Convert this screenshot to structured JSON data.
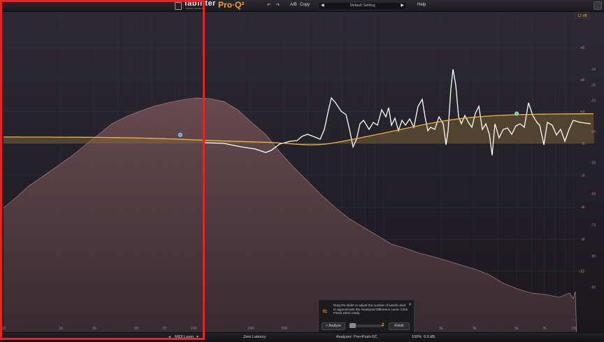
{
  "toolbar": {
    "undo_icon": "undo-icon",
    "redo_icon": "redo-icon",
    "ab_label": "A/B",
    "copy_label": "Copy",
    "preset_name": "Default Setting",
    "help_label": "Help"
  },
  "logo": {
    "brand": "fabfilter",
    "brand_sub": "software instruments",
    "product": "Pro·Q²"
  },
  "range": {
    "label": "12 dB"
  },
  "freq_axis": {
    "ticks": [
      {
        "label": "10",
        "hz": 10
      },
      {
        "label": "20",
        "hz": 20
      },
      {
        "label": "30",
        "hz": 30
      },
      {
        "label": "50",
        "hz": 50
      },
      {
        "label": "70",
        "hz": 70
      },
      {
        "label": "100",
        "hz": 100
      },
      {
        "label": "200",
        "hz": 200
      },
      {
        "label": "300",
        "hz": 300
      },
      {
        "label": "500",
        "hz": 500
      },
      {
        "label": "700",
        "hz": 700
      },
      {
        "label": "1k",
        "hz": 1000
      },
      {
        "label": "2k",
        "hz": 2000
      },
      {
        "label": "3k",
        "hz": 3000
      },
      {
        "label": "5k",
        "hz": 5000
      },
      {
        "label": "7k",
        "hz": 7000
      },
      {
        "label": "10k",
        "hz": 10000
      },
      {
        "label": "20k",
        "hz": 20000
      }
    ]
  },
  "eq_axis": {
    "ticks": [
      {
        "label": "+9",
        "db": 9
      },
      {
        "label": "+6",
        "db": 6
      },
      {
        "label": "+3",
        "db": 3
      },
      {
        "label": "0",
        "db": 0
      },
      {
        "label": "-3",
        "db": -3
      },
      {
        "label": "-6",
        "db": -6
      },
      {
        "label": "-9",
        "db": -9
      },
      {
        "label": "-12",
        "db": -12
      }
    ]
  },
  "spectrum_axis": {
    "ticks": [
      {
        "label": "-20",
        "db": -20
      },
      {
        "label": "-25",
        "db": -25
      },
      {
        "label": "-30",
        "db": -30
      },
      {
        "label": "-40",
        "db": -40
      },
      {
        "label": "-50",
        "db": -50
      },
      {
        "label": "-60",
        "db": -60
      },
      {
        "label": "-70",
        "db": -70
      },
      {
        "label": "-80",
        "db": -80
      },
      {
        "label": "-90",
        "db": -90
      }
    ]
  },
  "bands": [
    {
      "freq_hz": 85,
      "gain_db": 0.8,
      "color": "#4aa3ff"
    },
    {
      "freq_hz": 5000,
      "gain_db": 2.8,
      "color": "#5fe07a"
    }
  ],
  "dialog": {
    "message": "Drag the slider to adjust the number of bands used to approximate the measured difference curve. Click Finish when ready.",
    "analyze_label": "< Analyze",
    "value": "2",
    "finish_label": "Finish",
    "close_icon": "close-icon",
    "wave_icon": "approximate-icon"
  },
  "bottom": {
    "midi_learn": "MIDI Learn",
    "latency": "Zero Latency",
    "analyzer_label": "Analyzer:",
    "analyzer_value": "Pre+Post+SC",
    "zoom": "100%",
    "output_gain": "0.0 dB"
  },
  "colors": {
    "eq_curve": "#f0b43a",
    "eq_fill": "#8a6a3a",
    "measured_curve": "#ffffff",
    "spectrum_fill": "#5a4248",
    "spectrum_line": "#b5858c",
    "highlight_box": "#e0262b"
  }
}
